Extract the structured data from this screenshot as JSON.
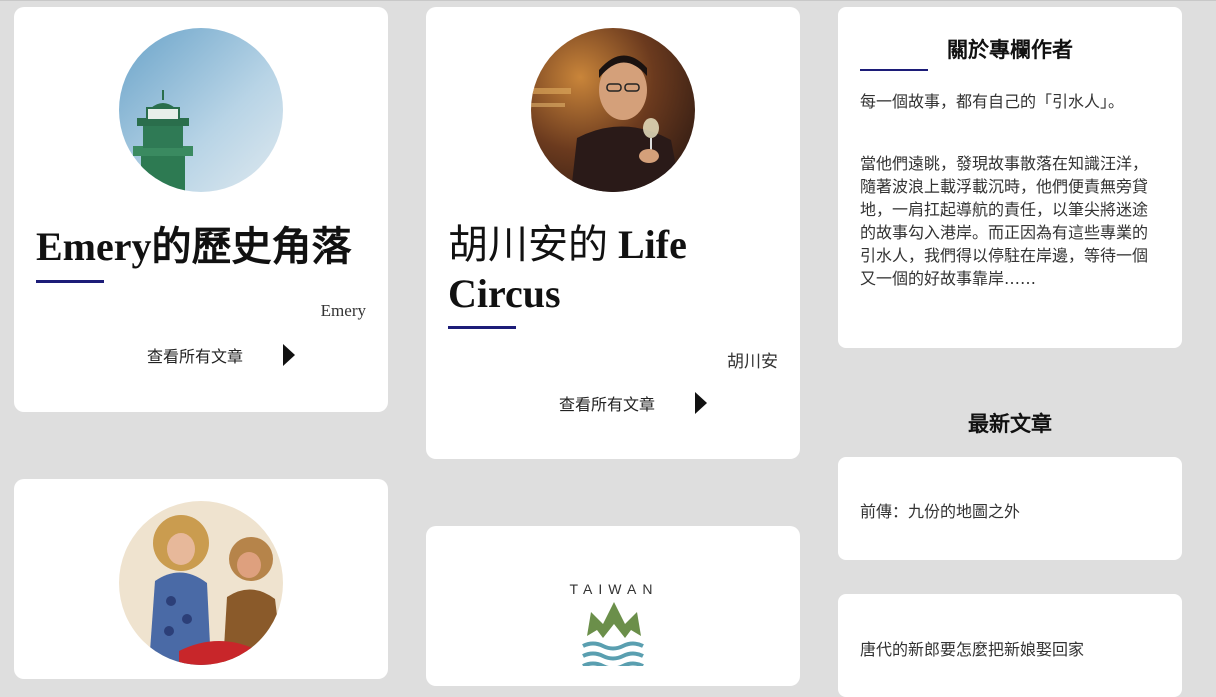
{
  "columns": [
    {
      "title_main": "Emery的歷史角落",
      "author": "Emery",
      "view_all": "查看所有文章"
    },
    {
      "title_cjk": "胡川安的",
      "title_en1": "Life",
      "title_en2": "Circus",
      "author": "胡川安",
      "view_all": "查看所有文章"
    }
  ],
  "sidebar": {
    "about_heading": "關於專欄作者",
    "about_p1": "每一個故事，都有自己的「引水人」。",
    "about_p2": "當他們遠眺，發現故事散落在知識汪洋，隨著波浪上載浮載沉時，他們便責無旁貸地，一肩扛起導航的責任，以筆尖將迷途的故事勾入港岸。而正因為有這些專業的引水人，我們得以停駐在岸邊，等待一個又一個的好故事靠岸……",
    "latest_heading": "最新文章",
    "latest": [
      "前傳：九份的地圖之外",
      "唐代的新郎要怎麼把新娘娶回家"
    ]
  },
  "logo": {
    "text": "TAIWAN"
  },
  "colors": {
    "accent_underline": "#1c1c78",
    "page_bg": "#dedede",
    "card_bg": "#ffffff"
  }
}
